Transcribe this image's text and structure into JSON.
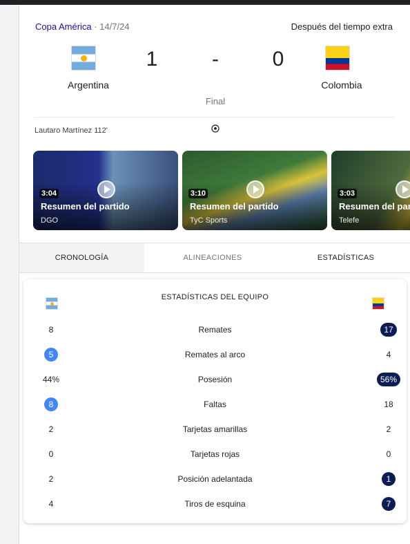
{
  "match": {
    "competition": "Copa América",
    "date": "· 14/7/24",
    "extra_time": "Después del tiempo extra",
    "home_team": "Argentina",
    "away_team": "Colombia",
    "home_score": "1",
    "away_score": "0",
    "score_separator": "-",
    "status": "Final",
    "scorer": "Lautaro Martínez 112'",
    "scorer_icon": "soccer-ball-icon"
  },
  "videos": [
    {
      "duration": "3:04",
      "title": "Resumen del partido",
      "source": "DGO"
    },
    {
      "duration": "3:10",
      "title": "Resumen del partido",
      "source": "TyC Sports"
    },
    {
      "duration": "3:03",
      "title": "Resumen del partido",
      "source": "Telefe"
    }
  ],
  "tabs": [
    "CRONOLOGÍA",
    "ALINEACIONES",
    "ESTADÍSTICAS"
  ],
  "stats": {
    "title": "ESTADÍSTICAS DEL EQUIPO",
    "rows": [
      {
        "label": "Remates",
        "home": "8",
        "away": "17",
        "highlight": "away"
      },
      {
        "label": "Remates al arco",
        "home": "5",
        "away": "4",
        "highlight": "home"
      },
      {
        "label": "Posesión",
        "home": "44%",
        "away": "56%",
        "highlight": "away"
      },
      {
        "label": "Faltas",
        "home": "8",
        "away": "18",
        "highlight": "home"
      },
      {
        "label": "Tarjetas amarillas",
        "home": "2",
        "away": "2",
        "highlight": "none"
      },
      {
        "label": "Tarjetas rojas",
        "home": "0",
        "away": "0",
        "highlight": "none"
      },
      {
        "label": "Posición adelantada",
        "home": "2",
        "away": "1",
        "highlight": "away"
      },
      {
        "label": "Tiros de esquina",
        "home": "4",
        "away": "7",
        "highlight": "away"
      }
    ]
  },
  "colors": {
    "home_highlight": "#4285f4",
    "away_highlight": "#0c1d55",
    "link": "#1a0dab"
  }
}
